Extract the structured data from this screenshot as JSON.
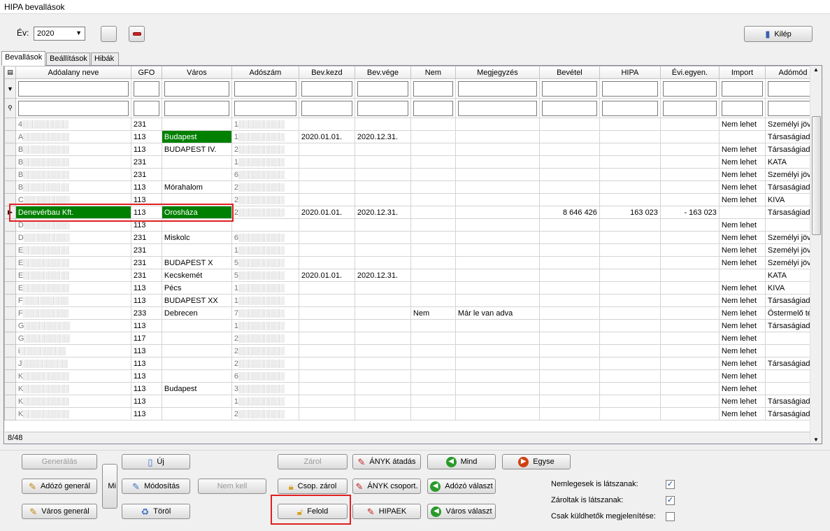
{
  "window": {
    "title": "HIPA bevallások"
  },
  "toolbar": {
    "year_label": "Év:",
    "year_value": "2020",
    "exit_label": "Kilép"
  },
  "tabs": [
    {
      "label": "Bevallások"
    },
    {
      "label": "Beállítások"
    },
    {
      "label": "Hibák"
    }
  ],
  "grid": {
    "columns": [
      "Adóalany neve",
      "GFO",
      "Város",
      "Adószám",
      "Bev.kezd",
      "Bev.vége",
      "Nem",
      "Megjegyzés",
      "Bevétel",
      "HIPA",
      "Évi.egyen.",
      "Import",
      "Adómód"
    ],
    "rows": [
      {
        "name": "4░░░░░░░░░",
        "gfo": "231",
        "city": "",
        "tax": "1░░░░░░░░░",
        "start": "",
        "end": "",
        "nem": "",
        "note": "",
        "rev": "",
        "hipa": "",
        "evi": "",
        "imp": "Nem lehet",
        "mode": "Személyi jöve"
      },
      {
        "name": "A░░░░░░░░░",
        "gfo": "113",
        "city": "Budapest",
        "tax": "1░░░░░░░░░",
        "start": "2020.01.01.",
        "end": "2020.12.31.",
        "nem": "",
        "note": "",
        "rev": "",
        "hipa": "",
        "evi": "",
        "imp": "",
        "mode": "Társaságiadó"
      },
      {
        "name": "B░░░░░░░░░",
        "gfo": "113",
        "city": "BUDAPEST IV.",
        "tax": "2░░░░░░░░░",
        "start": "",
        "end": "",
        "nem": "",
        "note": "",
        "rev": "",
        "hipa": "",
        "evi": "",
        "imp": "Nem lehet",
        "mode": "Társaságiadó"
      },
      {
        "name": "B░░░░░░░░░",
        "gfo": "231",
        "city": "",
        "tax": "1░░░░░░░░░",
        "start": "",
        "end": "",
        "nem": "",
        "note": "",
        "rev": "",
        "hipa": "",
        "evi": "",
        "imp": "Nem lehet",
        "mode": "KATA"
      },
      {
        "name": "B░░░░░░░░░",
        "gfo": "231",
        "city": "",
        "tax": "6░░░░░░░░░",
        "start": "",
        "end": "",
        "nem": "",
        "note": "",
        "rev": "",
        "hipa": "",
        "evi": "",
        "imp": "Nem lehet",
        "mode": "Személyi jöve"
      },
      {
        "name": "B░░░░░░░░░",
        "gfo": "113",
        "city": "Mórahalom",
        "tax": "2░░░░░░░░░",
        "start": "",
        "end": "",
        "nem": "",
        "note": "",
        "rev": "",
        "hipa": "",
        "evi": "",
        "imp": "Nem lehet",
        "mode": "Társaságiadó"
      },
      {
        "name": "C░░░░░░░░░",
        "gfo": "113",
        "city": "",
        "tax": "2░░░░░░░░░",
        "start": "",
        "end": "",
        "nem": "",
        "note": "",
        "rev": "",
        "hipa": "",
        "evi": "",
        "imp": "Nem lehet",
        "mode": "KIVA"
      },
      {
        "name": "Denevérbau Kft.",
        "gfo": "113",
        "city": "Orosháza",
        "tax": "2░░░░░░░░░",
        "start": "2020.01.01.",
        "end": "2020.12.31.",
        "nem": "",
        "note": "",
        "rev": "8 646 426",
        "hipa": "163 023",
        "evi": "- 163 023",
        "imp": "",
        "mode": "Társaságiadó"
      },
      {
        "name": "D░░░░░░░░░",
        "gfo": "113",
        "city": "",
        "tax": "",
        "start": "",
        "end": "",
        "nem": "",
        "note": "",
        "rev": "",
        "hipa": "",
        "evi": "",
        "imp": "Nem lehet",
        "mode": ""
      },
      {
        "name": "D░░░░░░░░░",
        "gfo": "231",
        "city": "Miskolc",
        "tax": "6░░░░░░░░░",
        "start": "",
        "end": "",
        "nem": "",
        "note": "",
        "rev": "",
        "hipa": "",
        "evi": "",
        "imp": "Nem lehet",
        "mode": "Személyi jöve"
      },
      {
        "name": "E░░░░░░░░░",
        "gfo": "231",
        "city": "",
        "tax": "1░░░░░░░░░",
        "start": "",
        "end": "",
        "nem": "",
        "note": "",
        "rev": "",
        "hipa": "",
        "evi": "",
        "imp": "Nem lehet",
        "mode": "Személyi jöve"
      },
      {
        "name": "E░░░░░░░░░",
        "gfo": "231",
        "city": "BUDAPEST X",
        "tax": "5░░░░░░░░░",
        "start": "",
        "end": "",
        "nem": "",
        "note": "",
        "rev": "",
        "hipa": "",
        "evi": "",
        "imp": "Nem lehet",
        "mode": "Személyi jöve"
      },
      {
        "name": "E░░░░░░░░░",
        "gfo": "231",
        "city": "Kecskemét",
        "tax": "5░░░░░░░░░",
        "start": "2020.01.01.",
        "end": "2020.12.31.",
        "nem": "",
        "note": "",
        "rev": "",
        "hipa": "",
        "evi": "",
        "imp": "",
        "mode": "KATA"
      },
      {
        "name": "E░░░░░░░░░",
        "gfo": "113",
        "city": "Pécs",
        "tax": "1░░░░░░░░░",
        "start": "",
        "end": "",
        "nem": "",
        "note": "",
        "rev": "",
        "hipa": "",
        "evi": "",
        "imp": "Nem lehet",
        "mode": "KIVA"
      },
      {
        "name": "F░░░░░░░░░",
        "gfo": "113",
        "city": "BUDAPEST XX",
        "tax": "1░░░░░░░░░",
        "start": "",
        "end": "",
        "nem": "",
        "note": "",
        "rev": "",
        "hipa": "",
        "evi": "",
        "imp": "Nem lehet",
        "mode": "Társaságiadó"
      },
      {
        "name": "F░░░░░░░░░",
        "gfo": "233",
        "city": "Debrecen",
        "tax": "7░░░░░░░░░",
        "start": "",
        "end": "",
        "nem": "Nem",
        "note": "Már le van adva",
        "rev": "",
        "hipa": "",
        "evi": "",
        "imp": "Nem lehet",
        "mode": "Östermelő téte"
      },
      {
        "name": "G░░░░░░░░░",
        "gfo": "113",
        "city": "",
        "tax": "1░░░░░░░░░",
        "start": "",
        "end": "",
        "nem": "",
        "note": "",
        "rev": "",
        "hipa": "",
        "evi": "",
        "imp": "Nem lehet",
        "mode": "Társaságiadó"
      },
      {
        "name": "G░░░░░░░░░",
        "gfo": "117",
        "city": "",
        "tax": "2░░░░░░░░░",
        "start": "",
        "end": "",
        "nem": "",
        "note": "",
        "rev": "",
        "hipa": "",
        "evi": "",
        "imp": "Nem lehet",
        "mode": ""
      },
      {
        "name": "i░░░░░░░░░",
        "gfo": "113",
        "city": "",
        "tax": "2░░░░░░░░░",
        "start": "",
        "end": "",
        "nem": "",
        "note": "",
        "rev": "",
        "hipa": "",
        "evi": "",
        "imp": "Nem lehet",
        "mode": ""
      },
      {
        "name": "J░░░░░░░░░",
        "gfo": "113",
        "city": "",
        "tax": "2░░░░░░░░░",
        "start": "",
        "end": "",
        "nem": "",
        "note": "",
        "rev": "",
        "hipa": "",
        "evi": "",
        "imp": "Nem lehet",
        "mode": "Társaságiadó"
      },
      {
        "name": "K░░░░░░░░░",
        "gfo": "113",
        "city": "",
        "tax": "6░░░░░░░░░",
        "start": "",
        "end": "",
        "nem": "",
        "note": "",
        "rev": "",
        "hipa": "",
        "evi": "",
        "imp": "Nem lehet",
        "mode": ""
      },
      {
        "name": "K░░░░░░░░░",
        "gfo": "113",
        "city": "Budapest",
        "tax": "3░░░░░░░░░",
        "start": "",
        "end": "",
        "nem": "",
        "note": "",
        "rev": "",
        "hipa": "",
        "evi": "",
        "imp": "Nem lehet",
        "mode": ""
      },
      {
        "name": "K░░░░░░░░░",
        "gfo": "113",
        "city": "",
        "tax": "1░░░░░░░░░",
        "start": "",
        "end": "",
        "nem": "",
        "note": "",
        "rev": "",
        "hipa": "",
        "evi": "",
        "imp": "Nem lehet",
        "mode": "Társaságiadó"
      },
      {
        "name": "K░░░░░░░░░",
        "gfo": "113",
        "city": "",
        "tax": "2░░░░░░░░░",
        "start": "",
        "end": "",
        "nem": "",
        "note": "",
        "rev": "",
        "hipa": "",
        "evi": "",
        "imp": "Nem lehet",
        "mode": "Társaságiadó"
      }
    ],
    "selected_row_index": 7,
    "green_cells": [
      {
        "row": 1,
        "col": "city"
      },
      {
        "row": 7,
        "col": "name"
      },
      {
        "row": 7,
        "col": "city"
      }
    ],
    "status": "8/48"
  },
  "buttons": {
    "generate": "Generálás",
    "taxpayer_generate": "Adózó generál",
    "city_generate": "Város generál",
    "mi": "Mi",
    "new": "Új",
    "modify": "Módosítás",
    "delete": "Töröl",
    "not_needed": "Nem kell",
    "lock": "Zárol",
    "group_lock": "Csop. zárol",
    "unlock": "Felold",
    "anyk_transfer": "ÁNYK átadás",
    "anyk_group": "ÁNYK csoport.",
    "hipaek": "HIPAEK",
    "all": "Mind",
    "taxpayer_select": "Adózó választ",
    "city_select": "Város választ",
    "single": "Egyse"
  },
  "options": [
    {
      "label": "Nemlegesek is látszanak:",
      "checked": true
    },
    {
      "label": "Zároltak is látszanak:",
      "checked": true
    },
    {
      "label": "Csak küldhetők megjelenítése:",
      "checked": false
    }
  ]
}
